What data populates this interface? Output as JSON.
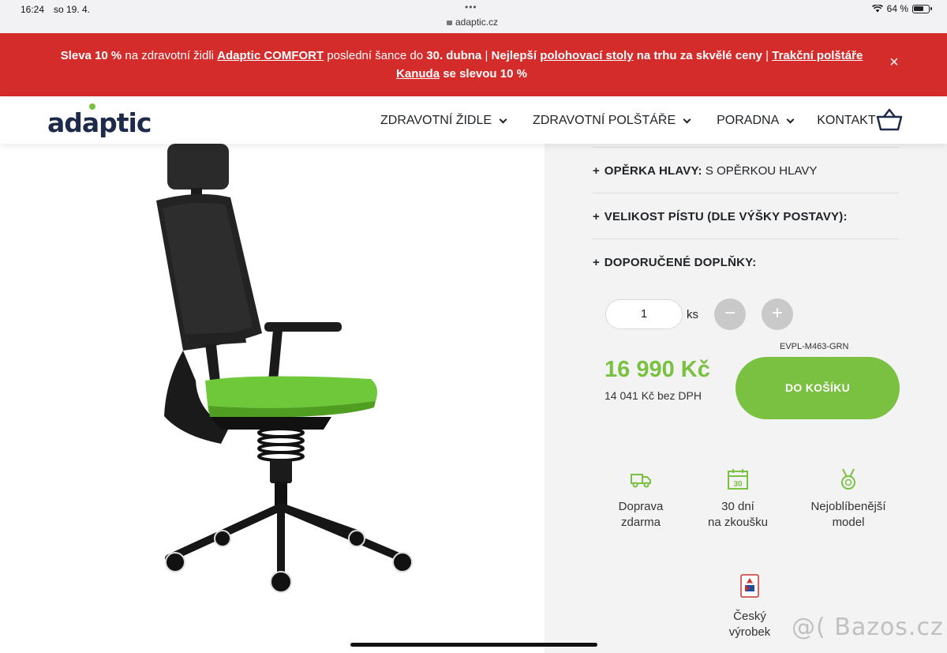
{
  "status_bar": {
    "time": "16:24",
    "date": "so 19. 4.",
    "url": "adaptic.cz",
    "battery": "64 %"
  },
  "promo": {
    "parts": [
      {
        "text": "Sleva 10 %",
        "style": "bold"
      },
      {
        "text": " na zdravotní židli ",
        "style": "normal"
      },
      {
        "text": "Adaptic COMFORT",
        "style": "link"
      },
      {
        "text": " poslední šance do ",
        "style": "normal"
      },
      {
        "text": "30. dubna",
        "style": "bold"
      },
      {
        "text": " | ",
        "style": "normal"
      },
      {
        "text": "Nejlepší ",
        "style": "bold"
      },
      {
        "text": "polohovací stoly",
        "style": "link"
      },
      {
        "text": " na trhu za skvělé ceny",
        "style": "bold"
      },
      {
        "text": " | ",
        "style": "normal"
      },
      {
        "text": "Trakční polštáře Kanuda",
        "style": "link"
      },
      {
        "text": " se slevou 10 %",
        "style": "bold"
      }
    ],
    "close": "×"
  },
  "header": {
    "logo": "adaptic",
    "nav": [
      {
        "label": "ZDRAVOTNÍ ŽIDLE",
        "dropdown": true
      },
      {
        "label": "ZDRAVOTNÍ POLŠTÁŘE",
        "dropdown": true
      },
      {
        "label": "PORADNA",
        "dropdown": true
      },
      {
        "label": "KONTAKT",
        "dropdown": false
      }
    ]
  },
  "options": [
    {
      "plus": "+",
      "label": "OPĚRKA HLAVY:",
      "value": " S OPĚRKOU HLAVY"
    },
    {
      "plus": "+",
      "label": "VELIKOST PÍSTU (DLE VÝŠKY POSTAVY):",
      "value": ""
    },
    {
      "plus": "+",
      "label": "DOPORUČENÉ DOPLŇKY:",
      "value": ""
    }
  ],
  "quantity": {
    "value": "1",
    "unit": "ks",
    "minus": "−",
    "plus": "+"
  },
  "sku": "EVPL-M463-GRN",
  "price": {
    "main": "16 990 Kč",
    "net": "14 041 Kč bez DPH"
  },
  "add_to_cart": "DO KOŠÍKU",
  "features": [
    {
      "icon": "truck-icon",
      "line1": "Doprava",
      "line2": "zdarma"
    },
    {
      "icon": "calendar-30-icon",
      "line1": "30 dní",
      "line2": "na zkoušku"
    },
    {
      "icon": "medal-icon",
      "line1": "Nejoblíbenější",
      "line2": "model"
    },
    {
      "icon": "czech-made-badge-icon",
      "line1": "Český",
      "line2": "výrobek"
    }
  ],
  "watermark": "@( Bazos.cz",
  "colors": {
    "promo_red": "#d42b2b",
    "accent_green": "#7ac142",
    "logo_navy": "#1e2a4a"
  }
}
